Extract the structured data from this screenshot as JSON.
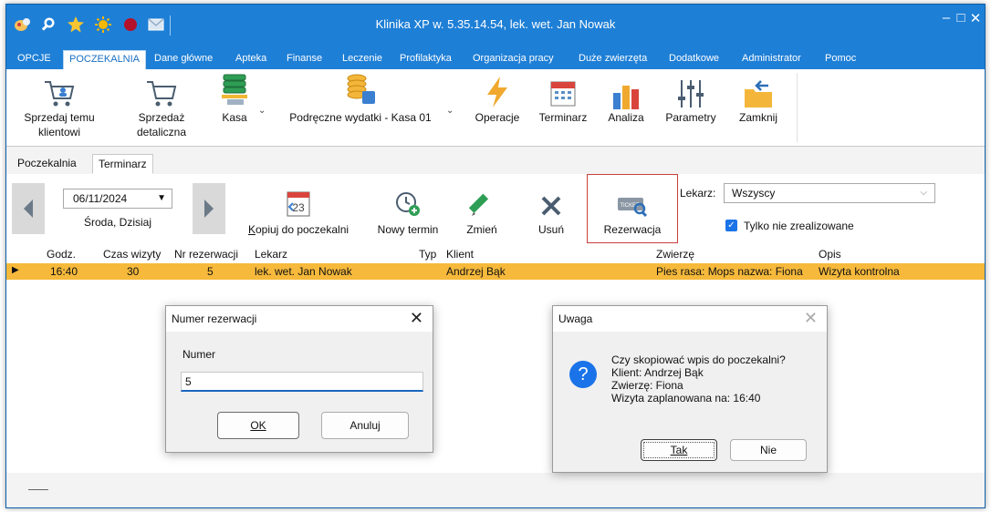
{
  "window": {
    "title": "Klinika XP w. 5.35.14.54, lek. wet. Jan Nowak",
    "controls": [
      "–",
      "□",
      "✕"
    ]
  },
  "quick_access": [
    "logo-icon",
    "search-icon",
    "star-icon",
    "sun-icon",
    "record-icon",
    "mail-icon"
  ],
  "menu_tabs": [
    {
      "label": "OPCJE"
    },
    {
      "label": "POCZEKALNIA",
      "active": true
    },
    {
      "label": "Dane główne"
    },
    {
      "label": "Apteka"
    },
    {
      "label": "Finanse"
    },
    {
      "label": "Leczenie"
    },
    {
      "label": "Profilaktyka"
    },
    {
      "label": "Organizacja pracy"
    },
    {
      "label": "Duże zwierzęta"
    },
    {
      "label": "Dodatkowe"
    },
    {
      "label": "Administrator"
    },
    {
      "label": "Pomoc"
    }
  ],
  "ribbon": {
    "sell_client": {
      "line1": "Sprzedaj temu",
      "line2": "klientowi"
    },
    "retail": {
      "line1": "Sprzedaż",
      "line2": "detaliczna"
    },
    "kasa": "Kasa",
    "petty_cash": "Podręczne wydatki - Kasa 01",
    "operations": "Operacje",
    "schedule": "Terminarz",
    "analysis": "Analiza",
    "parameters": "Parametry",
    "close": "Zamknij"
  },
  "sub_tabs": [
    {
      "label": "Poczekalnia"
    },
    {
      "label": "Terminarz",
      "active": true
    }
  ],
  "toolbar": {
    "date": "06/11/2024",
    "day_label": "Środa, Dzisiaj",
    "copy": {
      "label": "Kopiuj do poczekalni",
      "calendar_number": "23"
    },
    "new_term": "Nowy termin",
    "change": "Zmień",
    "delete": "Usuń",
    "reservation": "Rezerwacja",
    "ticket_text": "TICKET",
    "doctor_label": "Lekarz:",
    "doctor_value": "Wszyscy",
    "only_unrealized": "Tylko nie zrealizowane"
  },
  "grid": {
    "columns": [
      "Godz.",
      "Czas wizyty",
      "Nr rezerwacji",
      "Lekarz",
      "Typ",
      "Klient",
      "Zwierzę",
      "Opis"
    ],
    "rows": [
      {
        "godz": "16:40",
        "czas": "30",
        "nr": "5",
        "lekarz": "lek. wet. Jan Nowak",
        "typ": "",
        "klient": "Andrzej Bąk",
        "zwierze": "Pies rasa: Mops nazwa: Fiona",
        "opis": "Wizyta kontrolna"
      }
    ],
    "row_marker": "▶"
  },
  "dialog_number": {
    "title": "Numer rezerwacji",
    "label": "Numer",
    "value": "5",
    "ok": "OK",
    "cancel": "Anuluj"
  },
  "dialog_warning": {
    "title": "Uwaga",
    "line1": "Czy skopiować wpis do poczekalni?",
    "line2": "Klient: Andrzej Bąk",
    "line3": "Zwierzę: Fiona",
    "line4": "Wizyta zaplanowana na: 16:40",
    "yes": "Tak",
    "no": "Nie"
  },
  "colors": {
    "titlebar": "#1e7fd6",
    "row_highlight": "#f6b93b",
    "reservation_frame": "#c8403b",
    "question_icon": "#1a73e8"
  }
}
